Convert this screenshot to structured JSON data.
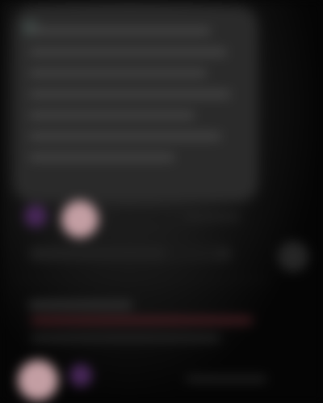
{
  "screen": {
    "visible_text": ""
  },
  "colors": {
    "background": "#050505",
    "card": "#2a2a2a",
    "text_placeholder": "#444444",
    "accent_purple": "#482759",
    "accent_pink": "#c39ea3",
    "muted_link": "#4c1f24"
  },
  "icons": {
    "more": "more-options-icon"
  }
}
